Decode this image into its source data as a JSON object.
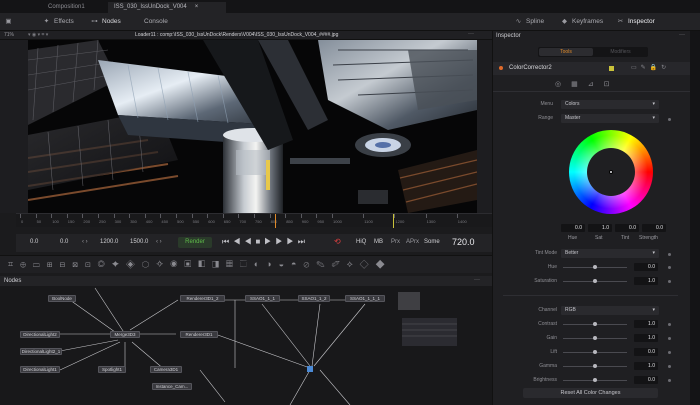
{
  "tabs": [
    "Composition1",
    "ISS_030_IssUnDock_V004"
  ],
  "toolbar": {
    "effects": "Effects",
    "nodes": "Nodes",
    "console": "Console",
    "spline": "Spline",
    "keyframes": "Keyframes",
    "inspector": "Inspector"
  },
  "viewer": {
    "zoom": "71%",
    "path": "Loader11 : comp:\\ISS_030_IssUnDock\\Renders\\V004\\ISS_030_IssUnDock_V004_####.jpg"
  },
  "ruler": {
    "ticks": [
      "0",
      "50",
      "100",
      "150",
      "200",
      "250",
      "300",
      "350",
      "400",
      "450",
      "500",
      "550",
      "600",
      "650",
      "700",
      "750",
      "800",
      "850",
      "900",
      "950",
      "1000",
      "1100",
      "1200",
      "1300",
      "1400"
    ]
  },
  "transport": {
    "start": "0.0",
    "render_start": "0.0",
    "render_end": "1200.0",
    "end": "1500.0",
    "render_button": "Render",
    "hiq": "HiQ",
    "mb": "MB",
    "prx": "Prx",
    "aprx": "APrx",
    "some": "Some",
    "current_frame": "720.0"
  },
  "nodes_panel": {
    "title": "Nodes",
    "nodes": [
      {
        "id": "BoolNode",
        "label": "BoolNode"
      },
      {
        "id": "DirectionalLight2",
        "label": "DirectionalLight2"
      },
      {
        "id": "DirectionalLight2_1",
        "label": "DirectionalLight2_1"
      },
      {
        "id": "DirectionalLight1",
        "label": "DirectionalLight1"
      },
      {
        "id": "Merge3D3",
        "label": "Merge3D3"
      },
      {
        "id": "Spotlight1",
        "label": "Spotlight1"
      },
      {
        "id": "Camera3D1",
        "label": "Camera3D1"
      },
      {
        "id": "Instance_Camera",
        "label": "Instance_Cam..."
      },
      {
        "id": "Renderer3D1_2",
        "label": "Renderer3D1_2"
      },
      {
        "id": "Renderer3D1",
        "label": "Renderer3D1"
      },
      {
        "id": "SSAO1_1_1",
        "label": "SSAO1_1_1"
      },
      {
        "id": "SSAO1_1_2",
        "label": "SSAO1_1_2"
      },
      {
        "id": "SSAO1_1_1_1",
        "label": "SSAO1_1_1_1"
      }
    ]
  },
  "inspector": {
    "title": "Inspector",
    "tab_tools": "Tools",
    "tab_modifiers": "Modifiers",
    "tool_name": "ColorCorrector2",
    "menu_label": "Menu",
    "menu_value": "Colors",
    "range_label": "Range",
    "range_value": "Master",
    "wheel_values": {
      "hue": "0.0",
      "sat": "1.0",
      "tint": "0.0",
      "strength": "0.0"
    },
    "wheel_labels": {
      "hue": "Hue",
      "sat": "Sat",
      "tint": "Tint",
      "strength": "Strength"
    },
    "tint_mode_label": "Tint Mode",
    "tint_mode_value": "Better",
    "hue_label": "Hue",
    "hue_value": "0.0",
    "hue_level": 0.5,
    "saturation_label": "Saturation",
    "saturation_value": "1.0",
    "saturation_level": 0.5,
    "channel_label": "Channel",
    "channel_value": "RGB",
    "contrast_label": "Contrast",
    "contrast_value": "1.0",
    "contrast_level": 0.5,
    "gain_label": "Gain",
    "gain_value": "1.0",
    "gain_level": 0.5,
    "lift_label": "Lift",
    "lift_value": "0.0",
    "lift_level": 0.5,
    "gamma_label": "Gamma",
    "gamma_value": "1.0",
    "gamma_level": 0.5,
    "brightness_label": "Brightness",
    "brightness_value": "0.0",
    "brightness_level": 0.5,
    "reset_button": "Reset All Color Changes"
  },
  "colors": {
    "accent_orange": "#e08a2a",
    "render_green": "#4e9a3c",
    "active_tab": "#232326"
  }
}
